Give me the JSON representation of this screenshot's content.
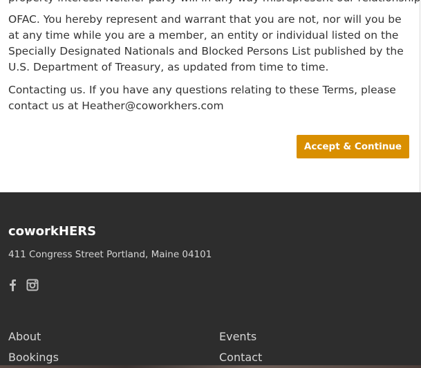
{
  "terms": {
    "partial_line": "property interest. Neither party will in any way misrepresent our relationship.",
    "ofac_paragraph": "OFAC. You hereby represent and warrant that you are not, nor will you be at any time while you are a member, an entity or individual listed on the Specially Designated Nationals and Blocked Persons List published by the U.S. Department of Treasury, as updated from time to time.",
    "contact_paragraph": "Contacting us. If you have any questions relating to these Terms, please contact us at Heather@coworkhers.com",
    "accept_label": "Accept & Continue"
  },
  "footer": {
    "brand": "coworkHERS",
    "address": "411 Congress Street Portland, Maine 04101",
    "social": [
      "facebook-icon",
      "instagram-icon"
    ],
    "links": {
      "about": "About",
      "bookings": "Bookings",
      "events": "Events",
      "contact": "Contact"
    }
  },
  "colors": {
    "accent": "#d98f00",
    "footer_bg": "#2d2d2d",
    "text": "#333333"
  }
}
